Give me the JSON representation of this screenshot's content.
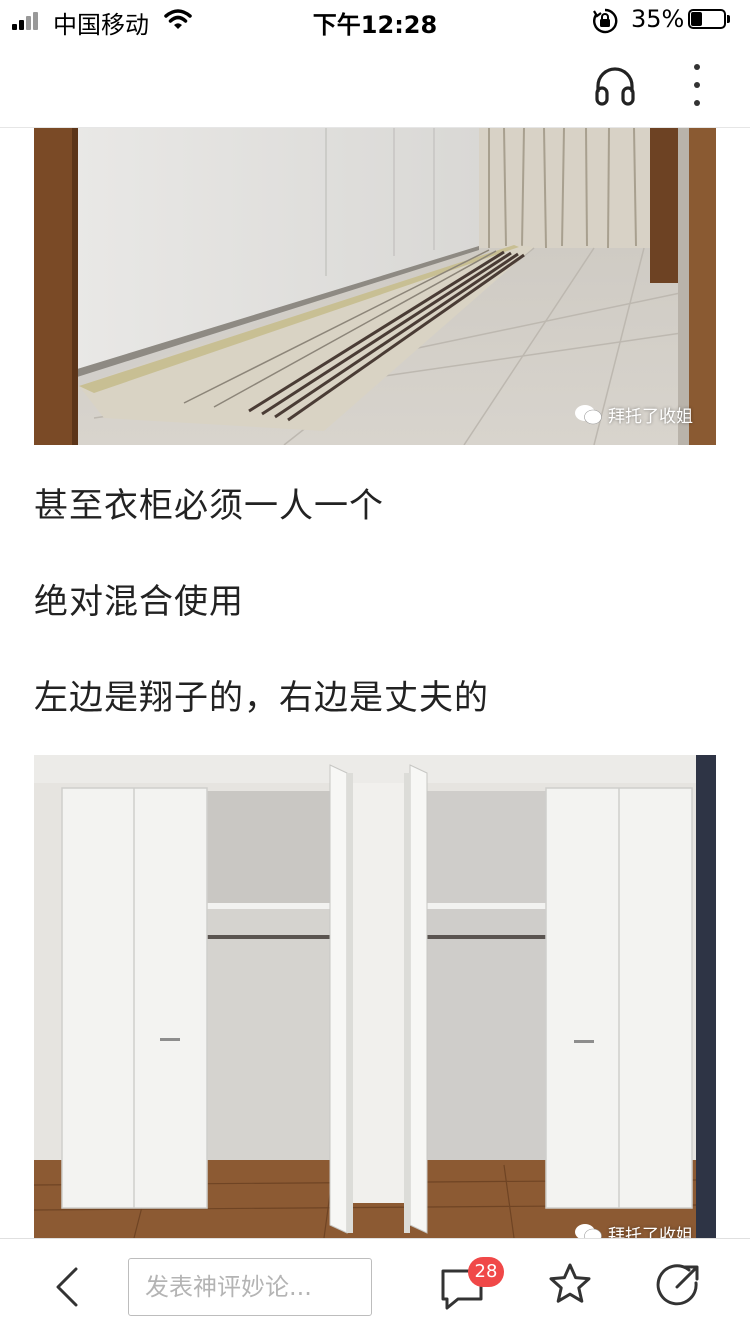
{
  "status_bar": {
    "carrier": "中国移动",
    "time": "下午12:28",
    "battery_percent": "35%",
    "battery_level": 0.35,
    "icons": [
      "signal-icon",
      "wifi-icon",
      "orientation-lock-icon",
      "battery-icon"
    ]
  },
  "nav_bar": {
    "icons": [
      "headphones-icon",
      "more-vertical-icon"
    ]
  },
  "article": {
    "image_watermark": "拜托了收姐",
    "paragraphs": [
      "甚至衣柜必须一人一个",
      "绝对混合使用",
      "左边是翔子的，右边是丈夫的"
    ]
  },
  "toolbar": {
    "comment_placeholder": "发表神评妙论...",
    "comment_count": "28",
    "icons": [
      "back-arrow-icon",
      "comment-bubble-icon",
      "star-icon",
      "share-icon"
    ],
    "badge_color": "#f04848"
  }
}
